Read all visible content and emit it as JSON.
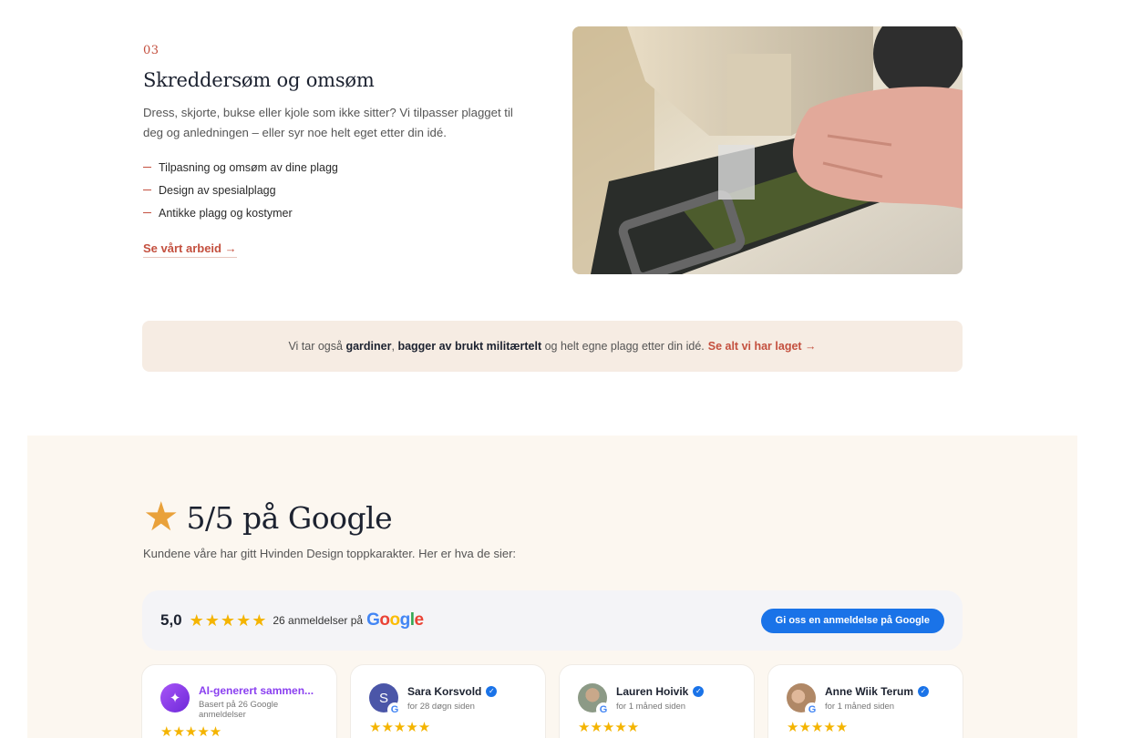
{
  "service": {
    "number": "03",
    "title": "Skreddersøm og omsøm",
    "description": "Dress, skjorte, bukse eller kjole som ikke sitter? Vi tilpasser plagget til deg og anledningen – eller syr noe helt eget etter din idé.",
    "items": [
      "Tilpasning og omsøm av dine plagg",
      "Design av spesialplagg",
      "Antikke plagg og kostymer"
    ],
    "link_label": "Se vårt arbeid →"
  },
  "banner": {
    "prefix": "Vi tar også",
    "bold1": "gardiner",
    "comma": ",",
    "bold2": "bagger av brukt militærtelt",
    "middle": "og helt egne plagg etter din idé.",
    "link_label": "Se alt vi har laget →"
  },
  "reviews": {
    "title": "5/5 på Google",
    "subtitle": "Kundene våre har gitt Hvinden Design toppkarakter. Her er hva de sier:",
    "score": "5,0",
    "rating": 5,
    "count_text": "26 anmeldelser på",
    "google_logo": "Google",
    "button_label": "Gi oss en anmeldelse på Google",
    "ai_card": {
      "title": "AI-generert sammen...",
      "subtitle": "Basert på 26 Google anmeldelser"
    },
    "cards": [
      {
        "name": "Sara Korsvold",
        "time": "for 28 døgn siden",
        "initial": "S",
        "avatar_color": "#4b56a8"
      },
      {
        "name": "Lauren Hoivik",
        "time": "for 1 måned siden",
        "initial": "",
        "avatar_color": "#8c9a86"
      },
      {
        "name": "Anne Wiik Terum",
        "time": "for 1 måned siden",
        "initial": "",
        "avatar_color": "#b08866"
      }
    ]
  },
  "colors": {
    "accent": "#c4503f",
    "star": "#f4b400",
    "google_blue": "#1a73e8",
    "banner_bg": "#f6ece3",
    "section_bg": "#fcf7f0"
  }
}
